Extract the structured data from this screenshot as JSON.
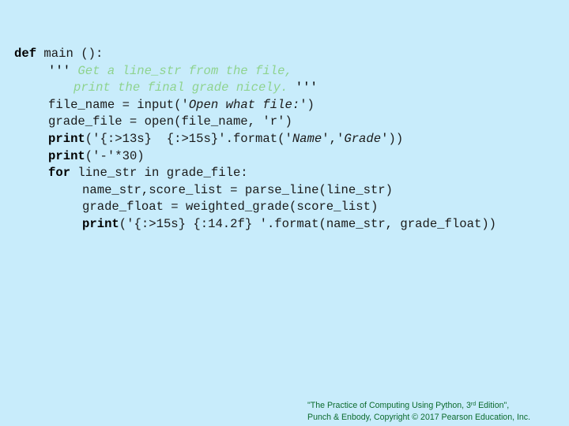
{
  "code": {
    "l1": {
      "kw": "def",
      "rest": " main ():"
    },
    "l2": {
      "open_quotes": "'''",
      "text": " Get a line_str from the file,"
    },
    "l3": {
      "text": "print the final grade nicely.",
      "close_quotes": " '''"
    },
    "l4": {
      "pre": "file_name = input('",
      "italic": "Open what file:",
      "post": "')"
    },
    "l5": {
      "text": "grade_file = open(file_name, 'r')"
    },
    "l6": {
      "kw": "print",
      "pre": "('{:>13s}  {:>15s}'.format('",
      "name": "Name",
      "mid": "','",
      "grade": "Grade",
      "post": "'))"
    },
    "l7": {
      "kw": "print",
      "rest": "('-'*30)"
    },
    "l8": {
      "kw": "for",
      "rest": " line_str in grade_file:"
    },
    "l9": {
      "text": "name_str,score_list = parse_line(line_str)"
    },
    "l10": {
      "text": "grade_float = weighted_grade(score_list)"
    },
    "l11": {
      "kw": "print",
      "rest": "('{:>15s} {:14.2f} '.format(name_str, grade_float))"
    }
  },
  "footer": {
    "line1_pre": "\"The Practice of Computing Using Python, 3",
    "line1_sup": "rd",
    "line1_post": " Edition\",",
    "line2": "Punch & Enbody, Copyright © 2017 Pearson Education, Inc."
  },
  "colors": {
    "background": "#c8ecfb",
    "docstring": "#8fd38f",
    "footer": "#0d6b2e"
  }
}
